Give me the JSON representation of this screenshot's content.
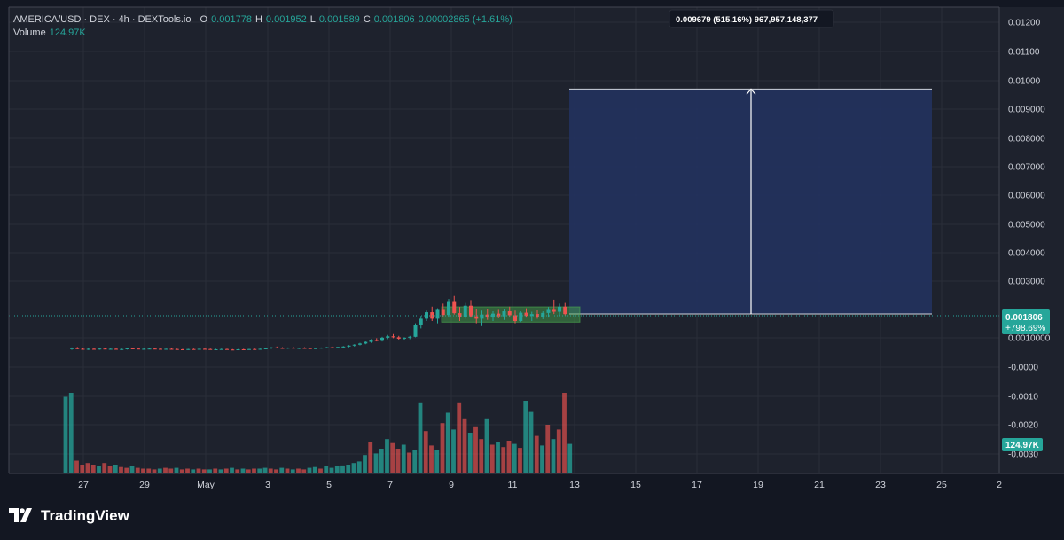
{
  "header": {
    "symbol": "AMERICA/USD · DEX · 4h · DEXTools.io",
    "open_label": "O",
    "open": "0.001778",
    "high_label": "H",
    "high": "0.001952",
    "low_label": "L",
    "low": "0.001589",
    "close_label": "C",
    "close": "0.001806",
    "change": "0.00002865 (+1.61%)",
    "volume_label": "Volume",
    "volume_value": "124.97K"
  },
  "measure_label": "0.009679 (515.16%) 967,957,148,377",
  "price_badge": {
    "price": "0.001806",
    "change": "+798.69%"
  },
  "volume_badge": "124.97K",
  "branding": {
    "name": "TradingView"
  },
  "colors": {
    "background": "#1e222d",
    "up": "#26a69a",
    "down": "#ef5350",
    "measure_fill": "#22325e",
    "range_box": "#4caf50"
  },
  "chart_data": {
    "type": "candlestick",
    "interval": "4h",
    "y_axis_ticks": [
      "0.01200",
      "0.01100",
      "0.01000",
      "0.009000",
      "0.008000",
      "0.007000",
      "0.006000",
      "0.005000",
      "0.004000",
      "0.003000",
      "0.0010000",
      "-0.0000",
      "-0.0010",
      "-0.0020",
      "-0.0030"
    ],
    "x_axis_ticks": [
      "27",
      "29",
      "May",
      "3",
      "5",
      "7",
      "9",
      "11",
      "13",
      "15",
      "17",
      "19",
      "21",
      "23",
      "25",
      "2"
    ],
    "ylim": [
      -0.0034,
      0.0126
    ],
    "measure": {
      "from": 0.001806,
      "to": 0.011485,
      "delta": 0.009679,
      "pct": "515.16%"
    },
    "range_box": {
      "low": 0.00145,
      "high": 0.00211
    },
    "day_index_start": 0,
    "candles": [
      [
        0.0003,
        0.00036,
        0.00026,
        0.00033
      ],
      [
        0.00033,
        0.00038,
        0.00028,
        0.0003
      ],
      [
        0.0003,
        0.00033,
        0.00026,
        0.00028
      ],
      [
        0.00028,
        0.00032,
        0.00025,
        0.0003
      ],
      [
        0.0003,
        0.00033,
        0.00027,
        0.00029
      ],
      [
        0.00029,
        0.00033,
        0.00026,
        0.00031
      ],
      [
        0.00031,
        0.00034,
        0.00028,
        0.00029
      ],
      [
        0.00029,
        0.00032,
        0.00026,
        0.0003
      ],
      [
        0.0003,
        0.00033,
        0.00027,
        0.00028
      ],
      [
        0.00028,
        0.00031,
        0.00025,
        0.00029
      ],
      [
        0.00029,
        0.00034,
        0.00027,
        0.00032
      ],
      [
        0.00032,
        0.00035,
        0.00029,
        0.00031
      ],
      [
        0.00031,
        0.00033,
        0.00028,
        0.00029
      ],
      [
        0.00029,
        0.00032,
        0.00026,
        0.0003
      ],
      [
        0.0003,
        0.00033,
        0.00028,
        0.00031
      ],
      [
        0.00031,
        0.00034,
        0.00029,
        0.0003
      ],
      [
        0.0003,
        0.00032,
        0.00027,
        0.00028
      ],
      [
        0.00028,
        0.00031,
        0.00026,
        0.0003
      ],
      [
        0.0003,
        0.00032,
        0.00027,
        0.00029
      ],
      [
        0.00029,
        0.00031,
        0.00026,
        0.00028
      ],
      [
        0.00028,
        0.0003,
        0.00025,
        0.00027
      ],
      [
        0.00027,
        0.0003,
        0.00025,
        0.00029
      ],
      [
        0.00029,
        0.00031,
        0.00026,
        0.00028
      ],
      [
        0.00028,
        0.00031,
        0.00026,
        0.0003
      ],
      [
        0.0003,
        0.00032,
        0.00027,
        0.00029
      ],
      [
        0.00029,
        0.00031,
        0.00026,
        0.00027
      ],
      [
        0.00027,
        0.0003,
        0.00025,
        0.00028
      ],
      [
        0.00028,
        0.00031,
        0.00026,
        0.00029
      ],
      [
        0.00029,
        0.00031,
        0.00026,
        0.00027
      ],
      [
        0.00027,
        0.00029,
        0.00024,
        0.00026
      ],
      [
        0.00026,
        0.00029,
        0.00024,
        0.00028
      ],
      [
        0.00028,
        0.0003,
        0.00025,
        0.00027
      ],
      [
        0.00027,
        0.0003,
        0.00025,
        0.00029
      ],
      [
        0.00029,
        0.00031,
        0.00026,
        0.00028
      ],
      [
        0.00028,
        0.00031,
        0.00026,
        0.0003
      ],
      [
        0.0003,
        0.00033,
        0.00028,
        0.00032
      ],
      [
        0.00032,
        0.00038,
        0.0003,
        0.00036
      ],
      [
        0.00036,
        0.0004,
        0.00032,
        0.00034
      ],
      [
        0.00034,
        0.00037,
        0.00031,
        0.00033
      ],
      [
        0.00033,
        0.00036,
        0.0003,
        0.00035
      ],
      [
        0.00035,
        0.00038,
        0.00031,
        0.00032
      ],
      [
        0.00032,
        0.00035,
        0.00029,
        0.00034
      ],
      [
        0.00034,
        0.00037,
        0.00031,
        0.00033
      ],
      [
        0.00033,
        0.00035,
        0.0003,
        0.00031
      ],
      [
        0.00031,
        0.00034,
        0.00029,
        0.00033
      ],
      [
        0.00033,
        0.00036,
        0.00031,
        0.00035
      ],
      [
        0.00035,
        0.00038,
        0.00033,
        0.00037
      ],
      [
        0.00037,
        0.0004,
        0.00034,
        0.00036
      ],
      [
        0.00036,
        0.00039,
        0.00033,
        0.00038
      ],
      [
        0.00038,
        0.00042,
        0.00035,
        0.0004
      ],
      [
        0.0004,
        0.00046,
        0.00037,
        0.00044
      ],
      [
        0.00044,
        0.0005,
        0.0004,
        0.00048
      ],
      [
        0.00048,
        0.00056,
        0.00045,
        0.00053
      ],
      [
        0.00053,
        0.00062,
        0.0005,
        0.0006
      ],
      [
        0.0006,
        0.00072,
        0.00056,
        0.00068
      ],
      [
        0.00068,
        0.00076,
        0.00062,
        0.00065
      ],
      [
        0.00065,
        0.00082,
        0.00062,
        0.00078
      ],
      [
        0.00078,
        0.0009,
        0.00072,
        0.00084
      ],
      [
        0.00084,
        0.00094,
        0.00076,
        0.0008
      ],
      [
        0.0008,
        0.00086,
        0.0007,
        0.00074
      ],
      [
        0.00074,
        0.0008,
        0.00068,
        0.00078
      ],
      [
        0.00078,
        0.00086,
        0.00072,
        0.00082
      ],
      [
        0.00082,
        0.0014,
        0.0008,
        0.00132
      ],
      [
        0.00132,
        0.00172,
        0.00118,
        0.0016
      ],
      [
        0.0016,
        0.00195,
        0.0015,
        0.00188
      ],
      [
        0.00188,
        0.00212,
        0.0015,
        0.0016
      ],
      [
        0.0016,
        0.00205,
        0.0014,
        0.00198
      ],
      [
        0.00198,
        0.00225,
        0.00168,
        0.00176
      ],
      [
        0.00176,
        0.00245,
        0.00165,
        0.00232
      ],
      [
        0.00232,
        0.00258,
        0.00178,
        0.00184
      ],
      [
        0.00184,
        0.0021,
        0.0015,
        0.00168
      ],
      [
        0.00168,
        0.00228,
        0.0016,
        0.00216
      ],
      [
        0.00216,
        0.0024,
        0.00165,
        0.0017
      ],
      [
        0.0017,
        0.002,
        0.0014,
        0.0016
      ],
      [
        0.0016,
        0.00195,
        0.00128,
        0.00178
      ],
      [
        0.00178,
        0.002,
        0.00155,
        0.00165
      ],
      [
        0.00165,
        0.00192,
        0.0015,
        0.00182
      ],
      [
        0.00182,
        0.00198,
        0.00162,
        0.0017
      ],
      [
        0.0017,
        0.002,
        0.00155,
        0.00192
      ],
      [
        0.00192,
        0.00212,
        0.00165,
        0.00175
      ],
      [
        0.00175,
        0.00195,
        0.0014,
        0.0015
      ],
      [
        0.0015,
        0.00192,
        0.00145,
        0.00186
      ],
      [
        0.00186,
        0.00205,
        0.00165,
        0.00172
      ],
      [
        0.00172,
        0.0019,
        0.0015,
        0.0018
      ],
      [
        0.0018,
        0.00196,
        0.0016,
        0.00168
      ],
      [
        0.00168,
        0.00192,
        0.00158,
        0.00185
      ],
      [
        0.00185,
        0.0021,
        0.00165,
        0.00198
      ],
      [
        0.00198,
        0.00242,
        0.0018,
        0.0019
      ],
      [
        0.0019,
        0.00225,
        0.00175,
        0.00212
      ],
      [
        0.00212,
        0.00228,
        0.00175,
        0.0018
      ]
    ],
    "volumes": [
      [
        0.95,
        1
      ],
      [
        1.0,
        1
      ],
      [
        0.15,
        0
      ],
      [
        0.1,
        0
      ],
      [
        0.12,
        0
      ],
      [
        0.1,
        0
      ],
      [
        0.08,
        1
      ],
      [
        0.12,
        0
      ],
      [
        0.08,
        0
      ],
      [
        0.1,
        1
      ],
      [
        0.07,
        0
      ],
      [
        0.06,
        0
      ],
      [
        0.08,
        1
      ],
      [
        0.06,
        0
      ],
      [
        0.05,
        0
      ],
      [
        0.05,
        0
      ],
      [
        0.04,
        0
      ],
      [
        0.05,
        1
      ],
      [
        0.06,
        0
      ],
      [
        0.05,
        0
      ],
      [
        0.06,
        1
      ],
      [
        0.04,
        0
      ],
      [
        0.05,
        0
      ],
      [
        0.04,
        1
      ],
      [
        0.05,
        0
      ],
      [
        0.04,
        0
      ],
      [
        0.04,
        1
      ],
      [
        0.05,
        0
      ],
      [
        0.04,
        1
      ],
      [
        0.05,
        0
      ],
      [
        0.06,
        1
      ],
      [
        0.04,
        0
      ],
      [
        0.05,
        1
      ],
      [
        0.04,
        0
      ],
      [
        0.05,
        0
      ],
      [
        0.05,
        1
      ],
      [
        0.06,
        1
      ],
      [
        0.05,
        0
      ],
      [
        0.04,
        0
      ],
      [
        0.06,
        1
      ],
      [
        0.05,
        0
      ],
      [
        0.04,
        1
      ],
      [
        0.05,
        0
      ],
      [
        0.04,
        0
      ],
      [
        0.06,
        1
      ],
      [
        0.07,
        1
      ],
      [
        0.05,
        0
      ],
      [
        0.08,
        1
      ],
      [
        0.06,
        1
      ],
      [
        0.08,
        1
      ],
      [
        0.09,
        1
      ],
      [
        0.1,
        1
      ],
      [
        0.12,
        1
      ],
      [
        0.14,
        1
      ],
      [
        0.22,
        1
      ],
      [
        0.38,
        0
      ],
      [
        0.24,
        1
      ],
      [
        0.3,
        1
      ],
      [
        0.42,
        1
      ],
      [
        0.37,
        0
      ],
      [
        0.3,
        0
      ],
      [
        0.35,
        1
      ],
      [
        0.25,
        0
      ],
      [
        0.28,
        1
      ],
      [
        0.88,
        1
      ],
      [
        0.52,
        0
      ],
      [
        0.34,
        0
      ],
      [
        0.28,
        1
      ],
      [
        0.62,
        0
      ],
      [
        0.75,
        1
      ],
      [
        0.54,
        1
      ],
      [
        0.88,
        0
      ],
      [
        0.68,
        0
      ],
      [
        0.5,
        1
      ],
      [
        0.58,
        0
      ],
      [
        0.42,
        0
      ],
      [
        0.68,
        1
      ],
      [
        0.35,
        0
      ],
      [
        0.38,
        1
      ],
      [
        0.32,
        0
      ],
      [
        0.4,
        0
      ],
      [
        0.36,
        1
      ],
      [
        0.31,
        0
      ],
      [
        0.9,
        1
      ],
      [
        0.76,
        1
      ],
      [
        0.46,
        0
      ],
      [
        0.34,
        1
      ],
      [
        0.6,
        0
      ],
      [
        0.42,
        1
      ],
      [
        0.54,
        0
      ],
      [
        1.0,
        0
      ],
      [
        0.36,
        1
      ]
    ]
  }
}
